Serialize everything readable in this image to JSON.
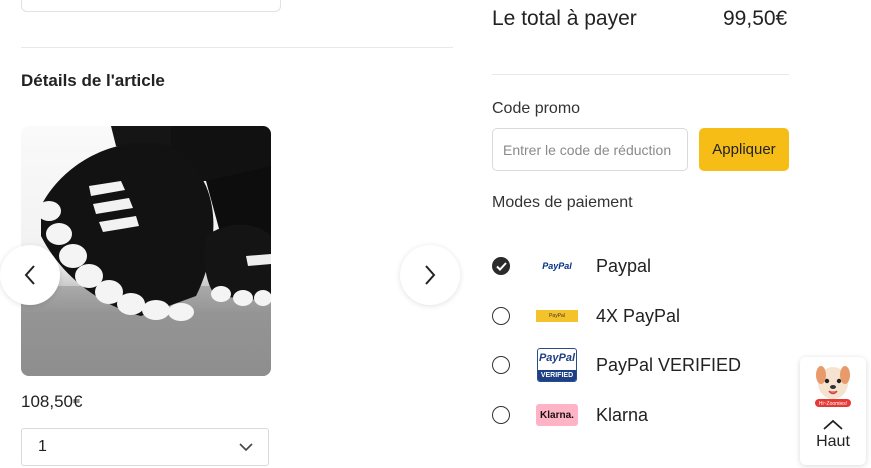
{
  "left": {
    "section_title": "Détails de l'article",
    "price": "108,50€",
    "quantity": "1"
  },
  "right": {
    "total_label": "Le total à payer",
    "total_value": "99,50€",
    "promo": {
      "label": "Code promo",
      "placeholder": "Entrer le code de réduction",
      "button": "Appliquer"
    },
    "payment": {
      "label": "Modes de paiement",
      "methods": [
        {
          "name": "Paypal",
          "logo_text": "PayPal",
          "selected": true
        },
        {
          "name": "4X PayPal",
          "logo_text": "PayPal",
          "selected": false
        },
        {
          "name": "PayPal VERIFIED",
          "logo_text": "PayPal",
          "logo_subtext": "VERIFIED",
          "selected": false
        },
        {
          "name": "Klarna",
          "logo_text": "Klarna.",
          "selected": false
        }
      ]
    }
  },
  "widget": {
    "mascot_label": "Hi~Zoomies!",
    "scroll_top_label": "Haut"
  },
  "colors": {
    "accent": "#f7bd17",
    "text": "#222222",
    "klarna_pink": "#ffb3c7",
    "paypal_blue": "#003087"
  }
}
